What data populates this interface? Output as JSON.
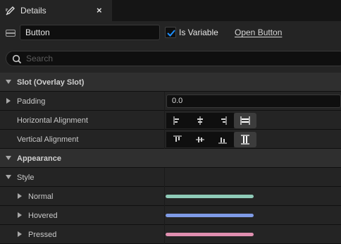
{
  "tab": {
    "title": "Details",
    "close": "×"
  },
  "widget": {
    "name": "Button",
    "is_variable_label": "Is Variable",
    "is_variable_checked": true,
    "open_button_label": "Open Button"
  },
  "search": {
    "placeholder": "Search"
  },
  "slot_section": {
    "title": "Slot (Overlay Slot)",
    "padding_label": "Padding",
    "padding_value": "0.0",
    "h_align_label": "Horizontal Alignment",
    "v_align_label": "Vertical Alignment",
    "h_align_options": [
      "align-left-icon",
      "align-center-icon",
      "align-right-icon",
      "align-fill-horizontal-icon"
    ],
    "h_align_selected": 3,
    "v_align_options": [
      "align-top-icon",
      "align-middle-icon",
      "align-bottom-icon",
      "align-fill-vertical-icon"
    ],
    "v_align_selected": 3
  },
  "appearance_section": {
    "title": "Appearance",
    "style_label": "Style",
    "states": [
      {
        "label": "Normal",
        "color": "#8fcbb8"
      },
      {
        "label": "Hovered",
        "color": "#7f9be6"
      },
      {
        "label": "Pressed",
        "color": "#e08fb0"
      }
    ]
  },
  "colors": {
    "checkbox_check": "#1e90ff",
    "active_button": "#3c3c3c"
  }
}
